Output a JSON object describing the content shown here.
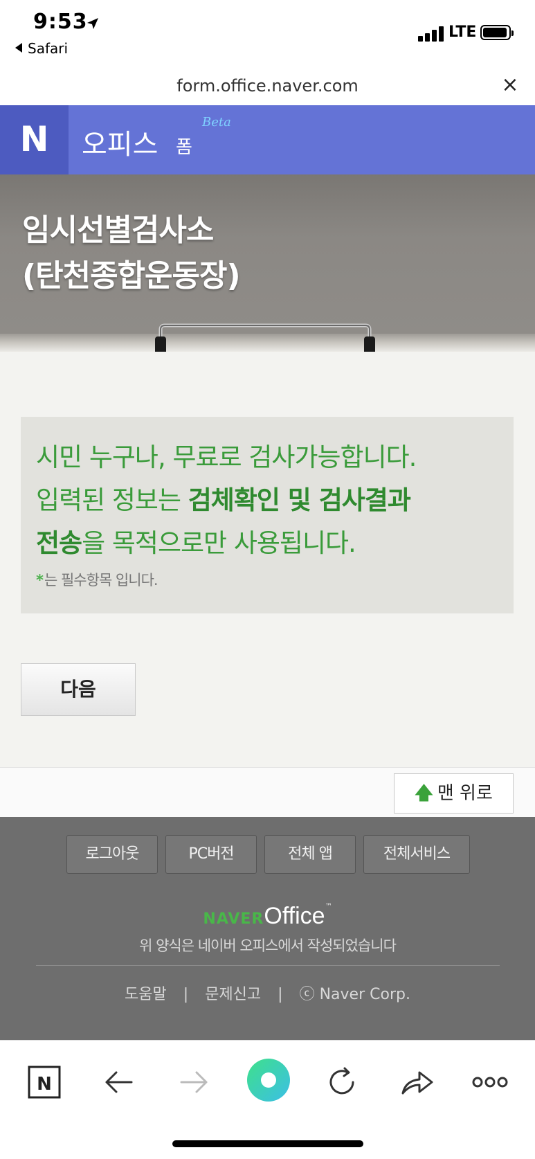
{
  "status_bar": {
    "time": "9:53",
    "back_app": "Safari",
    "network": "LTE"
  },
  "url_bar": {
    "url": "form.office.naver.com",
    "close_label": "×"
  },
  "header": {
    "logo": "N",
    "title": "오피스",
    "subtitle": "폼",
    "badge": "Beta",
    "color": "#6473d6"
  },
  "banner": {
    "title_line1": "임시선별검사소",
    "title_line2": "(탄천종합운동장)"
  },
  "notice": {
    "line1": "시민 누구나, 무료로 검사가능합니다.",
    "line2_prefix": "입력된 정보는 ",
    "line2_bold": "검체확인 및 검사결과",
    "line3_bold": "전송",
    "line3_suffix": "을 목적으로만 사용됩니다.",
    "required_star": "*",
    "required_note": "는 필수항목 입니다.",
    "color": "#3a9b3a"
  },
  "actions": {
    "next_label": "다음",
    "top_label": "맨 위로"
  },
  "footer": {
    "buttons": [
      "로그아웃",
      "PC버전",
      "전체 앱",
      "전체서비스"
    ],
    "brand_naver": "NAVER",
    "brand_office": "Office",
    "brand_tm": "™",
    "description": "위 양식은 네이버 오피스에서 작성되었습니다",
    "links": [
      "도움말",
      "문제신고",
      "ⓒ Naver Corp."
    ]
  },
  "toolbar": {
    "items": [
      "naver-home-icon",
      "back-arrow-icon",
      "forward-arrow-icon",
      "green-dot-icon",
      "refresh-icon",
      "share-icon",
      "more-icon"
    ]
  }
}
